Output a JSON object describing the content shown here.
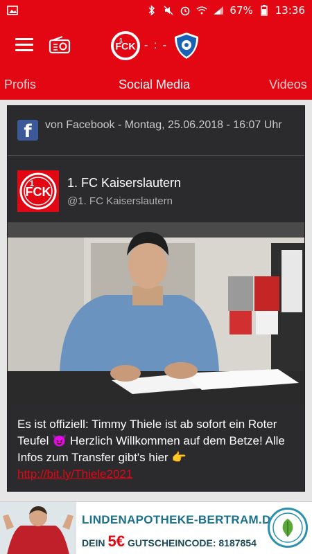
{
  "status_bar": {
    "battery": "67%",
    "time": "13:36"
  },
  "match": {
    "score": "- : -"
  },
  "tabs": [
    {
      "label": "Profis"
    },
    {
      "label": "Social Media"
    },
    {
      "label": "Videos"
    }
  ],
  "post": {
    "source": "von Facebook - Montag, 25.06.2018 - 16:07 Uhr",
    "account_name": "1. FC Kaiserslautern",
    "account_handle": "@1. FC Kaiserslautern",
    "text": "Es ist offiziell: Timmy Thiele ist ab sofort ein Roter Teufel 😈 Herzlich Willkommen auf dem Betze! Alle Infos zum Transfer gibt's hier 👉",
    "link": "http://bit.ly/Thiele2021"
  },
  "ad": {
    "title": "LINDENAPOTHEKE-BERTRAM.DE",
    "prefix": "DEIN",
    "amount": "5€",
    "code_text": "GUTSCHEINCODE: 8187854"
  },
  "colors": {
    "brand_red": "#e30613",
    "facebook_blue": "#3b5998",
    "link_red": "#e30613"
  }
}
